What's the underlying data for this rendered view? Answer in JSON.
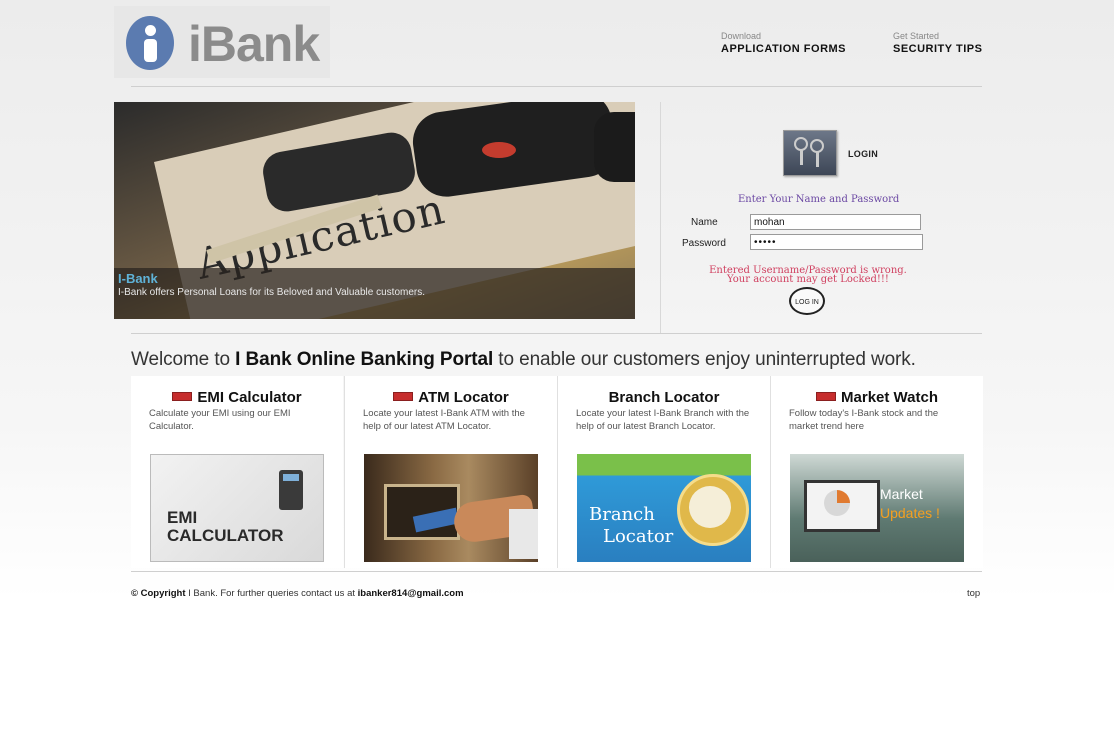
{
  "brand": {
    "name": "iBank"
  },
  "topnav": [
    {
      "small": "Download",
      "label": "APPLICATION FORMS"
    },
    {
      "small": "Get Started",
      "label": "SECURITY TIPS"
    }
  ],
  "hero": {
    "image_text": "Application",
    "caption_title": "I-Bank",
    "caption_text": "I-Bank offers Personal Loans for its Beloved and Valuable customers."
  },
  "login": {
    "title": "LOGIN",
    "prompt": "Enter Your Name and Password",
    "name_label": "Name",
    "name_value": "mohan",
    "password_label": "Password",
    "password_value": "•••••",
    "error_line1": "Entered Username/Password is wrong.",
    "error_line2": "Your account may get Locked!!!",
    "button": "LOG IN"
  },
  "welcome": {
    "prefix": "Welcome to ",
    "bold": "I Bank Online Banking Portal",
    "suffix": " to enable our customers enjoy uninterrupted work."
  },
  "panels": [
    {
      "title": "EMI Calculator",
      "desc": "Calculate your EMI using our EMI Calculator.",
      "img_line1": "EMI",
      "img_line2": "CALCULATOR"
    },
    {
      "title": "ATM Locator",
      "desc": "Locate your latest I-Bank ATM with the help of our latest ATM Locator."
    },
    {
      "title": "Branch Locator",
      "desc": "Locate your latest I-Bank Branch with the help of our latest Branch Locator.",
      "img_line1": "Branch",
      "img_line2": "Locator"
    },
    {
      "title": "Market Watch",
      "desc": "Follow today's I-Bank stock and the market trend here",
      "img_line1": "Market",
      "img_line2": "Updates !"
    }
  ],
  "footer": {
    "copyright": "© Copyright",
    "text": " I Bank. For further queries contact us at ",
    "email": "ibanker814@gmail.com",
    "top": "top"
  },
  "colors": {
    "accent": "#5b7bb0",
    "error": "#d04060",
    "prompt": "#6b48a3"
  }
}
